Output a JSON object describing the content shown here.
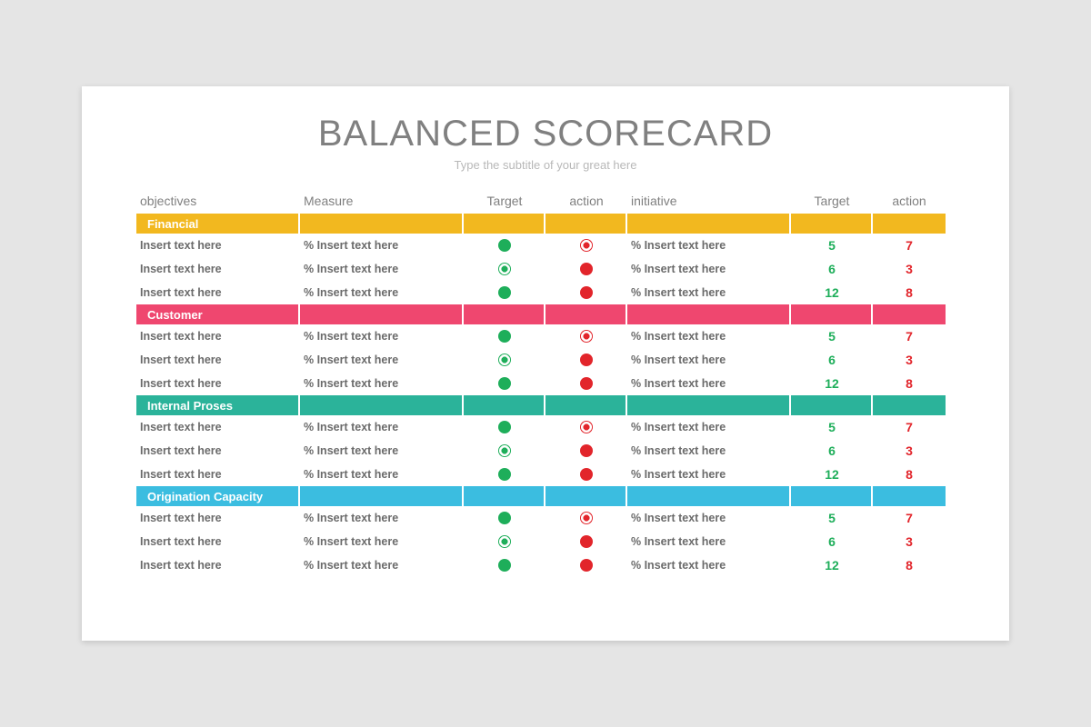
{
  "title": "BALANCED SCORECARD",
  "subtitle": "Type the subtitle of your great here",
  "columns": [
    "objectives",
    "Measure",
    "Target",
    "action",
    "initiative",
    "Target",
    "action"
  ],
  "sections": [
    {
      "name": "Financial",
      "color": "#f2b81f",
      "rows": [
        {
          "obj": "Insert text here",
          "measure": "% Insert text here",
          "t1": "green",
          "a1": "ring-red",
          "init": "% Insert text here",
          "t2": "5",
          "a2": "7"
        },
        {
          "obj": "Insert text here",
          "measure": "% Insert text here",
          "t1": "ring-green",
          "a1": "red",
          "init": "% Insert text here",
          "t2": "6",
          "a2": "3"
        },
        {
          "obj": "Insert text here",
          "measure": "% Insert text here",
          "t1": "green",
          "a1": "red",
          "init": "% Insert text here",
          "t2": "12",
          "a2": "8"
        }
      ]
    },
    {
      "name": "Customer",
      "color": "#ef476f",
      "rows": [
        {
          "obj": "Insert text here",
          "measure": "% Insert text here",
          "t1": "green",
          "a1": "ring-red",
          "init": "% Insert text here",
          "t2": "5",
          "a2": "7"
        },
        {
          "obj": "Insert text here",
          "measure": "% Insert text here",
          "t1": "ring-green",
          "a1": "red",
          "init": "% Insert text here",
          "t2": "6",
          "a2": "3"
        },
        {
          "obj": "Insert text here",
          "measure": "% Insert text here",
          "t1": "green",
          "a1": "red",
          "init": "% Insert text here",
          "t2": "12",
          "a2": "8"
        }
      ]
    },
    {
      "name": "Internal Proses",
      "color": "#2bb39a",
      "rows": [
        {
          "obj": "Insert text here",
          "measure": "% Insert text here",
          "t1": "green",
          "a1": "ring-red",
          "init": "% Insert text here",
          "t2": "5",
          "a2": "7"
        },
        {
          "obj": "Insert text here",
          "measure": "% Insert text here",
          "t1": "ring-green",
          "a1": "red",
          "init": "% Insert text here",
          "t2": "6",
          "a2": "3"
        },
        {
          "obj": "Insert text here",
          "measure": "% Insert text here",
          "t1": "green",
          "a1": "red",
          "init": "% Insert text here",
          "t2": "12",
          "a2": "8"
        }
      ]
    },
    {
      "name": "Origination Capacity",
      "color": "#3bbde0",
      "rows": [
        {
          "obj": "Insert text here",
          "measure": "% Insert text here",
          "t1": "green",
          "a1": "ring-red",
          "init": "% Insert text here",
          "t2": "5",
          "a2": "7"
        },
        {
          "obj": "Insert text here",
          "measure": "% Insert text here",
          "t1": "ring-green",
          "a1": "red",
          "init": "% Insert text here",
          "t2": "6",
          "a2": "3"
        },
        {
          "obj": "Insert text here",
          "measure": "% Insert text here",
          "t1": "green",
          "a1": "red",
          "init": "% Insert text here",
          "t2": "12",
          "a2": "8"
        }
      ]
    }
  ]
}
